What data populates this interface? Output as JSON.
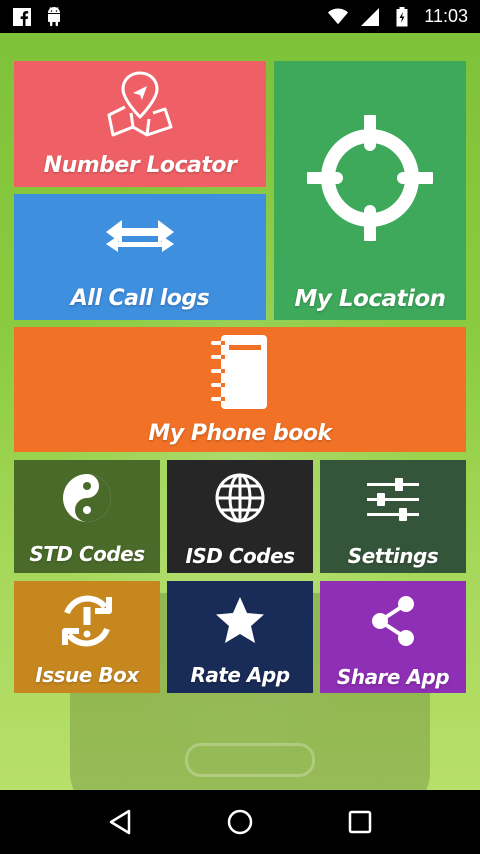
{
  "status_bar": {
    "time": "11:03",
    "icons": [
      "facebook-icon",
      "android-icon",
      "wifi-icon",
      "signal-icon",
      "battery-icon"
    ]
  },
  "tiles": {
    "number_locator": {
      "label": "Number Locator",
      "icon": "map-pin-icon",
      "color": "#ee6065"
    },
    "call_logs": {
      "label": "All Call logs",
      "icon": "swap-arrows-icon",
      "color": "#3f8fdf"
    },
    "my_location": {
      "label": "My Location",
      "icon": "crosshair-icon",
      "color": "#3ea85b"
    },
    "phone_book": {
      "label": "My Phone book",
      "icon": "notebook-icon",
      "color": "#f17126"
    },
    "std_codes": {
      "label": "STD Codes",
      "icon": "yin-yang-icon",
      "color": "#4a6a2a"
    },
    "isd_codes": {
      "label": "ISD Codes",
      "icon": "globe-icon",
      "color": "#262626"
    },
    "settings": {
      "label": "Settings",
      "icon": "sliders-icon",
      "color": "#35553a"
    },
    "issue_box": {
      "label": "Issue Box",
      "icon": "refresh-alert-icon",
      "color": "#c7871f"
    },
    "rate_app": {
      "label": "Rate App",
      "icon": "star-icon",
      "color": "#192c57"
    },
    "share_app": {
      "label": "Share App",
      "icon": "share-icon",
      "color": "#8e2fb5"
    }
  },
  "nav_bar": {
    "buttons": [
      "back-icon",
      "home-icon",
      "recents-icon"
    ]
  }
}
